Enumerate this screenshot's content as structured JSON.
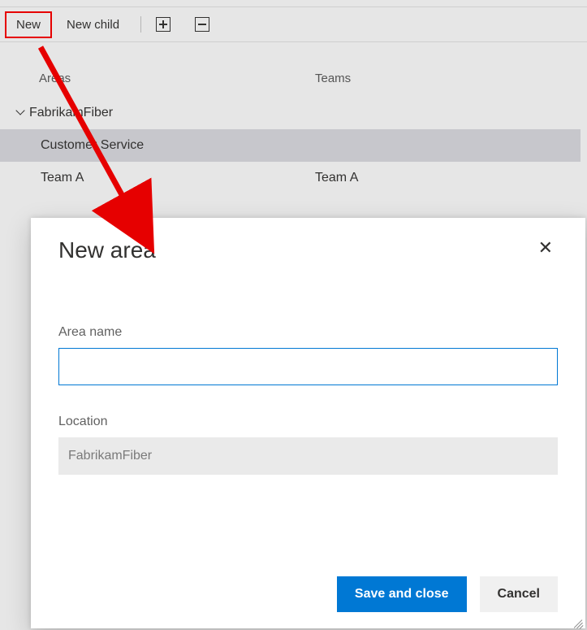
{
  "toolbar": {
    "new_label": "New",
    "new_child_label": "New child"
  },
  "columns": {
    "areas": "Areas",
    "teams": "Teams"
  },
  "tree": {
    "root_label": "FabrikamFiber",
    "rows": [
      {
        "area": "Customer Service",
        "team": ""
      },
      {
        "area": "Team A",
        "team": "Team A"
      }
    ]
  },
  "dialog": {
    "title": "New area",
    "area_name_label": "Area name",
    "area_name_value": "",
    "location_label": "Location",
    "location_value": "FabrikamFiber",
    "save_label": "Save and close",
    "cancel_label": "Cancel"
  },
  "annotation": {
    "highlight": "New",
    "arrow": true
  }
}
